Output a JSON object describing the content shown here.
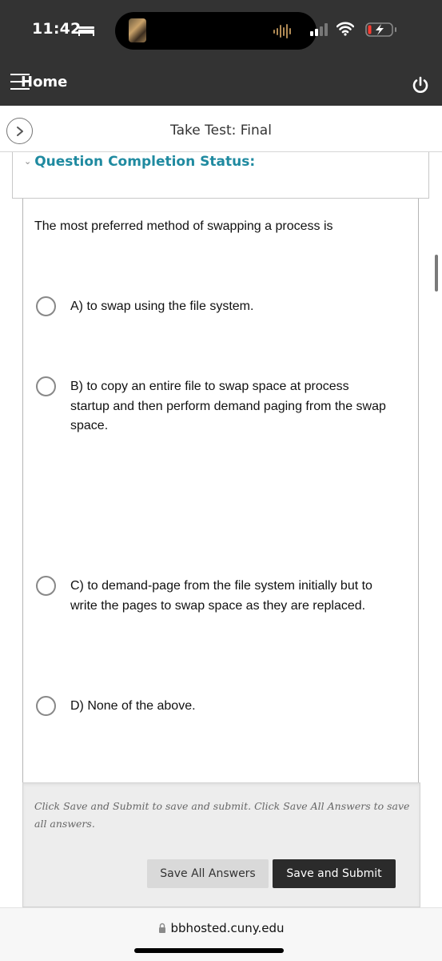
{
  "status_bar": {
    "time": "11:42",
    "sleep_icon": "bed-icon",
    "signal_icon": "cellular-signal-icon",
    "wifi_icon": "wifi-icon",
    "battery_icon": "battery-charging-icon",
    "battery_level": 0.15
  },
  "app_header": {
    "home_label": "Home",
    "menu_icon": "hamburger-icon",
    "power_icon": "power-icon"
  },
  "page": {
    "title": "Take Test: Final",
    "nav_toggle_icon": "chevron-right-icon"
  },
  "completion_status": {
    "title": "Question Completion Status:",
    "icon": "double-chevron-down-icon"
  },
  "question": {
    "text": "The most preferred method of swapping a process is",
    "options": [
      {
        "label": "A) to swap using the file system.",
        "selected": false
      },
      {
        "label": "B) to copy an entire file to swap space at process startup and then perform demand paging from the swap space.",
        "selected": false
      },
      {
        "label": "C) to demand-page from the file system initially but to write the pages to swap space as they are replaced.",
        "selected": false
      },
      {
        "label": "D) None of the above.",
        "selected": false
      }
    ]
  },
  "submit": {
    "instructions": "Click Save and Submit to save and submit. Click Save All Answers to save all answers.",
    "save_all_label": "Save All Answers",
    "save_submit_label": "Save and Submit"
  },
  "browser": {
    "url": "bbhosted.cuny.edu",
    "lock_icon": "lock-icon"
  },
  "colors": {
    "header_bg": "#333333",
    "accent": "#1f8aa0",
    "primary_button": "#2b2b2b",
    "secondary_button": "#d9d9d9"
  }
}
